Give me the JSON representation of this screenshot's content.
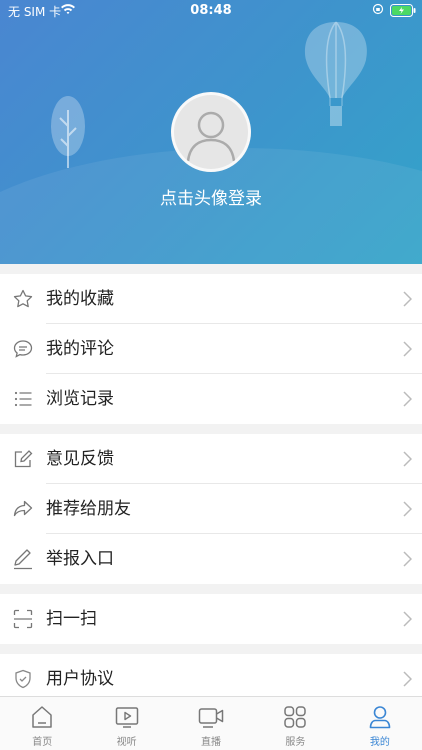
{
  "status_bar": {
    "carrier": "无 SIM 卡",
    "time": "08:48"
  },
  "header": {
    "login_prompt": "点击头像登录"
  },
  "menu_groups": [
    {
      "items": [
        {
          "label": "我的收藏",
          "icon": "star-icon"
        },
        {
          "label": "我的评论",
          "icon": "comment-icon"
        },
        {
          "label": "浏览记录",
          "icon": "list-icon"
        }
      ]
    },
    {
      "items": [
        {
          "label": "意见反馈",
          "icon": "edit-icon"
        },
        {
          "label": "推荐给朋友",
          "icon": "share-icon"
        },
        {
          "label": "举报入口",
          "icon": "pencil-icon"
        }
      ]
    },
    {
      "items": [
        {
          "label": "扫一扫",
          "icon": "scan-icon"
        }
      ]
    },
    {
      "items": [
        {
          "label": "用户协议",
          "icon": "shield-icon"
        }
      ]
    }
  ],
  "tabbar": [
    {
      "label": "首页",
      "icon": "home-icon"
    },
    {
      "label": "视听",
      "icon": "video-icon"
    },
    {
      "label": "直播",
      "icon": "live-icon"
    },
    {
      "label": "服务",
      "icon": "grid-icon"
    },
    {
      "label": "我的",
      "icon": "user-icon",
      "active": true
    }
  ],
  "colors": {
    "accent": "#3a86d4",
    "header_start": "#4a86d1",
    "header_end": "#33a4c9"
  }
}
